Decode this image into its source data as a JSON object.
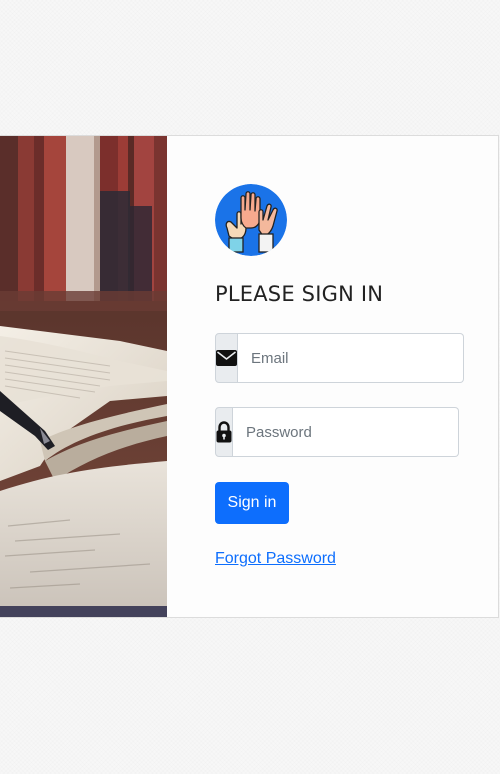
{
  "login": {
    "title": "PLEASE SIGN IN",
    "email_placeholder": "Email",
    "password_placeholder": "Password",
    "signin_label": "Sign in",
    "forgot_label": "Forgot Password"
  },
  "icons": {
    "email": "envelope-icon",
    "password": "lock-icon",
    "logo": "raised-hands-logo",
    "photo": "open-book-photo"
  },
  "colors": {
    "primary": "#0d6efd",
    "addon_bg": "#e9ecef",
    "logo_bg": "#1a73e8",
    "title": "#222222"
  }
}
